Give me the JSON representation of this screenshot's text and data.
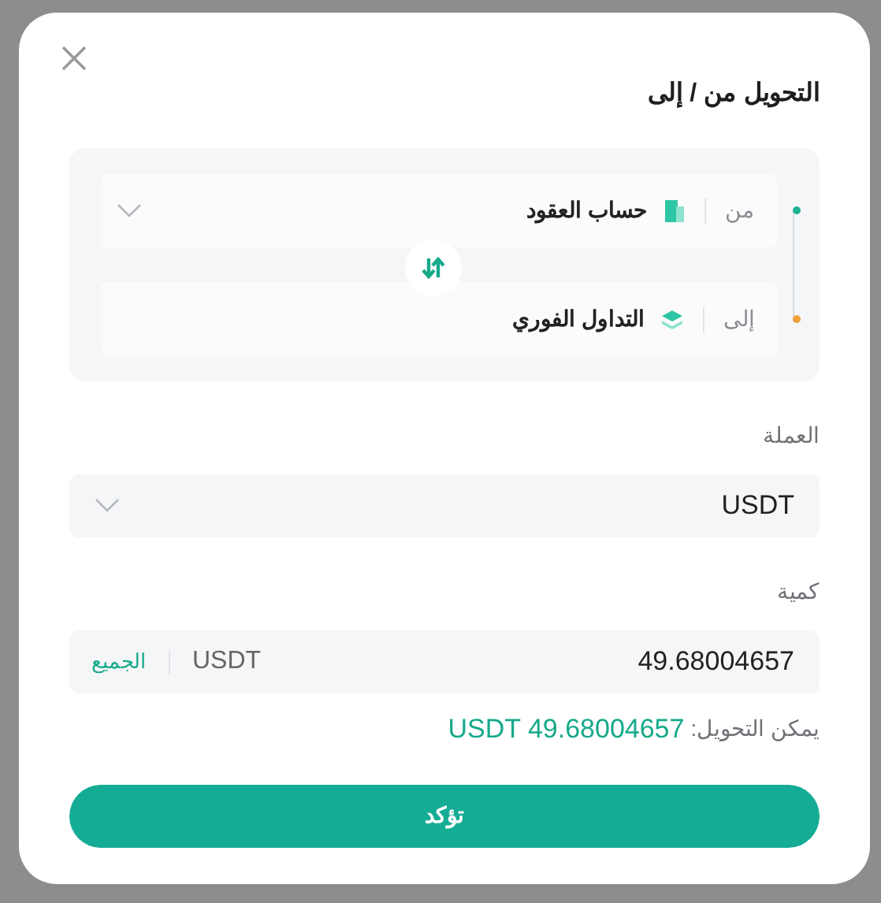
{
  "title": "التحويل من / إلى",
  "transfer": {
    "rows": [
      {
        "label": "من",
        "account": "حساب العقود",
        "color": "#1bb394",
        "kind": "contract",
        "dropdown": true
      },
      {
        "label": "إلى",
        "account": "التداول الفوري",
        "color": "#f0a03c",
        "kind": "spot",
        "dropdown": false
      }
    ]
  },
  "currency": {
    "label": "العملة",
    "value": "USDT"
  },
  "amount": {
    "label": "كمية",
    "value": "49.68004657",
    "unit": "USDT",
    "max_link": "الجميع"
  },
  "available": {
    "label": "يمكن التحويل:",
    "value": "USDT 49.68004657"
  },
  "confirm_button": "تؤكد"
}
